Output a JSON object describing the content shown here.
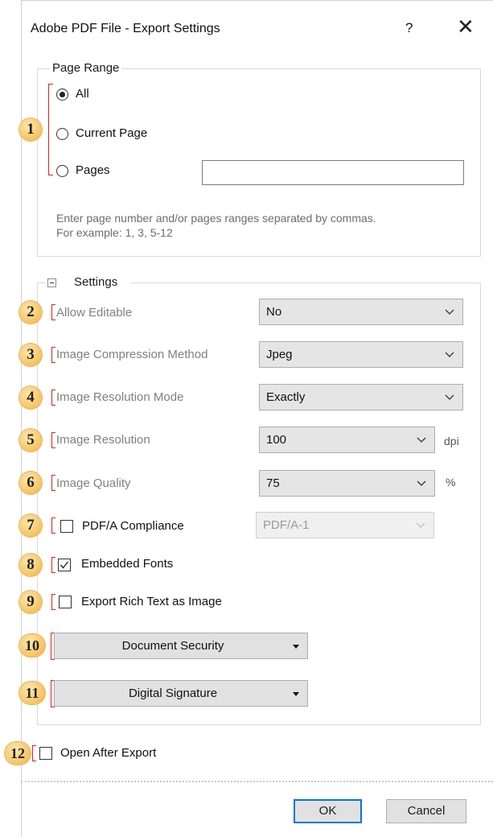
{
  "window": {
    "title": "Adobe PDF File - Export Settings",
    "help": "?",
    "close": "✕"
  },
  "page_range": {
    "legend": "Page Range",
    "options": [
      "All",
      "Current Page",
      "Pages"
    ],
    "selected": "All",
    "pages_value": "",
    "hint_line1": "Enter page number and/or pages ranges separated by commas.",
    "hint_line2": "For example: 1, 3, 5-12"
  },
  "settings": {
    "legend": "Settings",
    "allow_editable": {
      "label": "Allow Editable",
      "value": "No"
    },
    "image_compression": {
      "label": "Image Compression Method",
      "value": "Jpeg"
    },
    "image_resolution_mode": {
      "label": "Image Resolution Mode",
      "value": "Exactly"
    },
    "image_resolution": {
      "label": "Image Resolution",
      "value": "100",
      "unit": "dpi"
    },
    "image_quality": {
      "label": "Image Quality",
      "value": "75",
      "unit": "%"
    },
    "pdfa": {
      "label": "PDF/A Compliance",
      "checked": false,
      "value": "PDF/A-1"
    },
    "embedded_fonts": {
      "label": "Embedded Fonts",
      "checked": true
    },
    "rich_text": {
      "label": "Export Rich Text as Image",
      "checked": false
    },
    "document_security": {
      "label": "Document Security"
    },
    "digital_signature": {
      "label": "Digital Signature"
    }
  },
  "open_after_export": {
    "label": "Open After Export",
    "checked": false
  },
  "buttons": {
    "ok": "OK",
    "cancel": "Cancel"
  },
  "badges": [
    "1",
    "2",
    "3",
    "4",
    "5",
    "6",
    "7",
    "8",
    "9",
    "10",
    "11",
    "12"
  ],
  "colors": {
    "badge": "#f6c25f",
    "bracket": "#e02020",
    "default_button_border": "#0078d7"
  }
}
